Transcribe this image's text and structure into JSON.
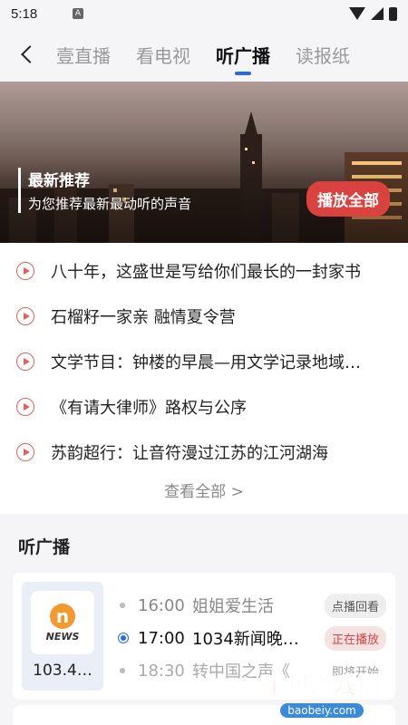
{
  "status": {
    "time": "5:18"
  },
  "nav": {
    "tabs": [
      {
        "label": "壹直播"
      },
      {
        "label": "看电视"
      },
      {
        "label": "听广播"
      },
      {
        "label": "读报纸"
      }
    ]
  },
  "banner": {
    "title": "最新推荐",
    "subtitle": "为您推荐最新最动听的声音",
    "play_all": "播放全部"
  },
  "list": {
    "items": [
      "八十年，这盛世是写给你们最长的一封家书",
      "石榴籽一家亲 融情夏令营",
      "文学节目：钟楼的早晨—用文学记录地域…",
      "《有请大律师》路权与公序",
      "苏韵超行：让音符漫过江苏的江河湖海"
    ],
    "view_all": "查看全部  >"
  },
  "section": {
    "title": "听广播",
    "station": {
      "logo_text": "NEWS",
      "freq": "103.4…",
      "schedule": [
        {
          "time": "16:00",
          "name": "姐姐爱生活",
          "tag": "点播回看"
        },
        {
          "time": "17:00",
          "name": "1034新闻晚…",
          "tag": "正在播放"
        },
        {
          "time": "18:30",
          "name": "转中国之声《…",
          "tag": "即将开始"
        }
      ]
    }
  },
  "watermark": {
    "title": "宝贝游戏网",
    "url": "baobeiy.com"
  }
}
